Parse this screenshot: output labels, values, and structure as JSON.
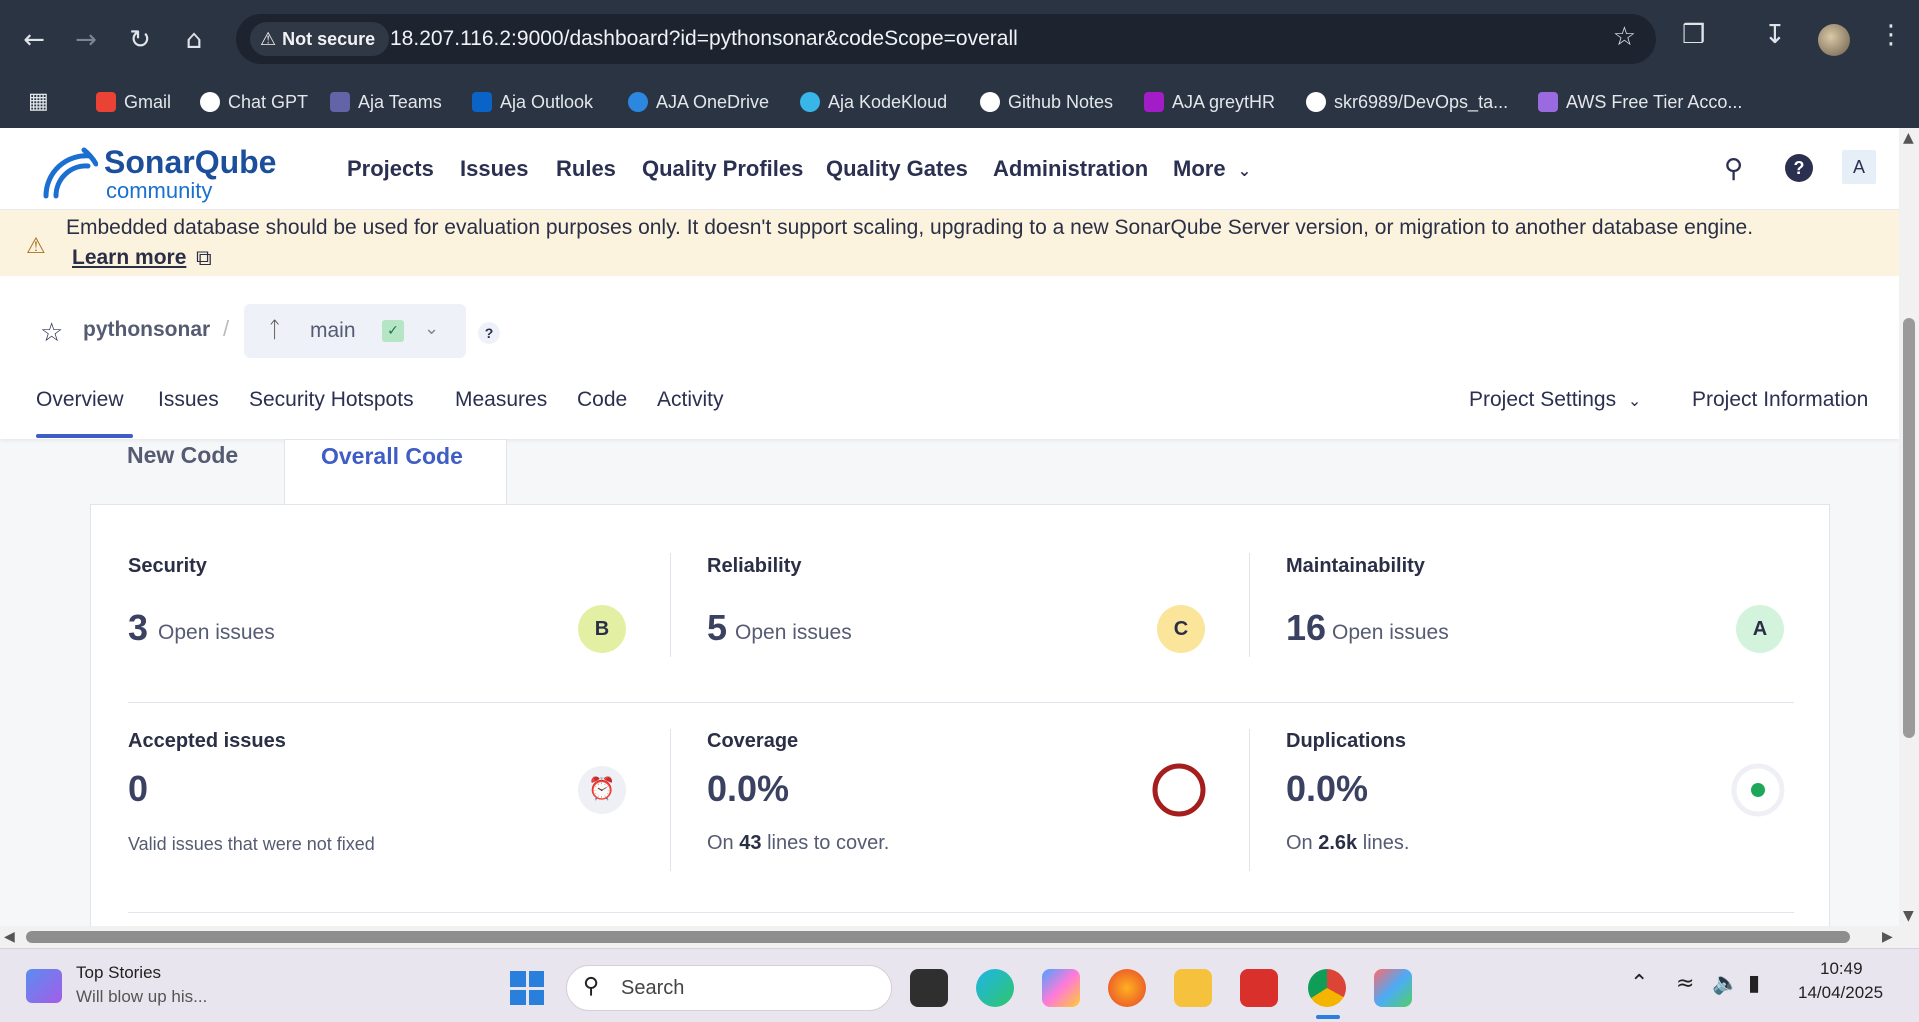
{
  "browser": {
    "security_label": "Not secure",
    "url": "18.207.116.2:9000/dashboard?id=pythonsonar&codeScope=overall",
    "bookmarks": [
      {
        "label": "Gmail",
        "icon": "gmail-icon",
        "color": "#ea4335"
      },
      {
        "label": "Chat GPT",
        "icon": "chatgpt-icon",
        "color": "#ffffff"
      },
      {
        "label": "Aja Teams",
        "icon": "teams-icon",
        "color": "#6264a7"
      },
      {
        "label": "Aja Outlook",
        "icon": "outlook-icon",
        "color": "#0a64c8"
      },
      {
        "label": "AJA OneDrive",
        "icon": "onedrive-icon",
        "color": "#2c87e0"
      },
      {
        "label": "Aja KodeKloud",
        "icon": "kodekloud-icon",
        "color": "#38b6e8"
      },
      {
        "label": "Github Notes",
        "icon": "github-icon",
        "color": "#ffffff"
      },
      {
        "label": "AJA greytHR",
        "icon": "greythr-icon",
        "color": "#a21cc8"
      },
      {
        "label": "skr6989/DevOps_ta...",
        "icon": "github-icon",
        "color": "#ffffff"
      },
      {
        "label": "AWS Free Tier Acco...",
        "icon": "aws-icon",
        "color": "#9b6ae0"
      }
    ]
  },
  "header": {
    "logo_primary": "SonarQube",
    "logo_secondary": "community",
    "nav": [
      "Projects",
      "Issues",
      "Rules",
      "Quality Profiles",
      "Quality Gates",
      "Administration",
      "More"
    ],
    "avatar_letter": "A",
    "help_symbol": "?"
  },
  "banner": {
    "message": "Embedded database should be used for evaluation purposes only. It doesn't support scaling, upgrading to a new SonarQube Server version, or migration to another database engine.",
    "link": "Learn more"
  },
  "project": {
    "name": "pythonsonar",
    "branch": "main",
    "help_symbol": "?",
    "tabs": [
      "Overview",
      "Issues",
      "Security Hotspots",
      "Measures",
      "Code",
      "Activity"
    ],
    "settings_label": "Project Settings",
    "info_label": "Project Information"
  },
  "scope_tabs": {
    "new": "New Code",
    "overall": "Overall Code"
  },
  "metrics": {
    "security": {
      "title": "Security",
      "count": "3",
      "sub": "Open issues",
      "grade": "B",
      "grade_color": "#e3f0a4"
    },
    "reliability": {
      "title": "Reliability",
      "count": "5",
      "sub": "Open issues",
      "grade": "C",
      "grade_color": "#fbe59b"
    },
    "maintainability": {
      "title": "Maintainability",
      "count": "16",
      "sub": "Open issues",
      "grade": "A",
      "grade_color": "#d3f3dd"
    },
    "accepted": {
      "title": "Accepted issues",
      "count": "0",
      "footer": "Valid issues that were not fixed"
    },
    "coverage": {
      "title": "Coverage",
      "value": "0.0%",
      "foot_prefix": "On",
      "foot_value": "43",
      "foot_suffix": "lines to cover.",
      "ring_color": "#a51d1d"
    },
    "duplications": {
      "title": "Duplications",
      "value": "0.0%",
      "foot_prefix": "On",
      "foot_value": "2.6k",
      "foot_suffix": "lines.",
      "dot_color": "#1ca75b"
    }
  },
  "taskbar": {
    "news_title": "Top Stories",
    "news_sub": "Will blow up his...",
    "search_placeholder": "Search",
    "time": "10:49",
    "date": "14/04/2025"
  }
}
